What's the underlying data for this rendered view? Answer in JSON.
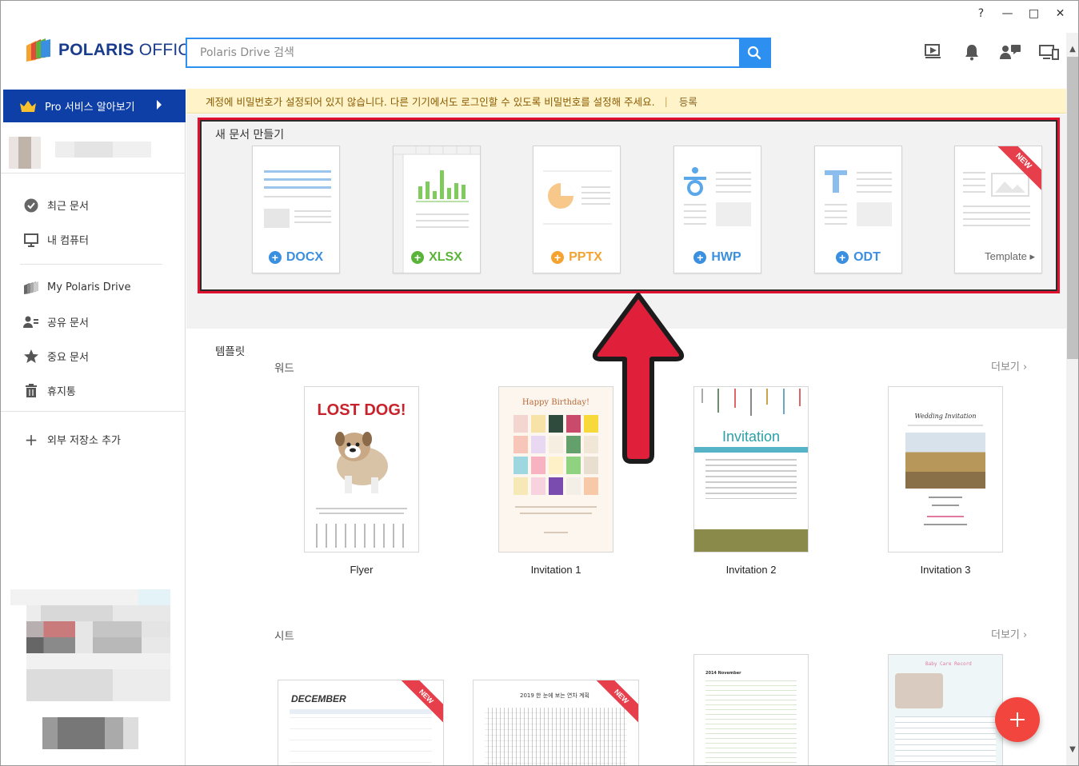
{
  "window": {
    "controls": [
      "?",
      "—",
      "□",
      "✕"
    ]
  },
  "app": {
    "logo_text_bold": "POLARIS",
    "logo_text_light": " OFFICE"
  },
  "search": {
    "placeholder": "Polaris Drive 검색"
  },
  "header_icons": [
    "present-icon",
    "bell-icon",
    "chat-users-icon",
    "devices-icon"
  ],
  "sidebar": {
    "pro_label": "Pro 서비스 알아보기",
    "items_top": [
      {
        "label": "최근 문서",
        "icon": "check-circle-icon"
      },
      {
        "label": "내 컴퓨터",
        "icon": "monitor-icon"
      }
    ],
    "items_mid": [
      {
        "label": "My Polaris Drive",
        "icon": "drive-icon"
      },
      {
        "label": "공유 문서",
        "icon": "share-users-icon"
      },
      {
        "label": "중요 문서",
        "icon": "star-icon"
      },
      {
        "label": "휴지통",
        "icon": "trash-icon"
      }
    ],
    "add_storage": "외부 저장소 추가"
  },
  "notice": {
    "text": "계정에 비밀번호가 설정되어 있지 않습니다. 다른 기기에서도 로그인할 수 있도록 비밀번호를 설정해 주세요.",
    "divider": "|",
    "action": "등록"
  },
  "new_doc": {
    "title": "새 문서 만들기",
    "types": [
      {
        "label": "DOCX",
        "color": "#3a8fe0"
      },
      {
        "label": "XLSX",
        "color": "#5bb43a"
      },
      {
        "label": "PPTX",
        "color": "#f4a330"
      },
      {
        "label": "HWP",
        "color": "#3a8fe0"
      },
      {
        "label": "ODT",
        "color": "#3a8fe0"
      }
    ],
    "template_label": "Template",
    "new_badge": "NEW"
  },
  "templates": {
    "title": "템플릿",
    "word": {
      "title": "워드",
      "more": "더보기",
      "items": [
        {
          "name": "Flyer",
          "headline": "LOST DOG!"
        },
        {
          "name": "Invitation 1",
          "headline": "Happy Birthday!"
        },
        {
          "name": "Invitation 2",
          "headline": "Invitation"
        },
        {
          "name": "Invitation 3",
          "headline": "Wedding Invitation"
        }
      ]
    },
    "sheet": {
      "title": "시트",
      "more": "더보기",
      "items": [
        {
          "headline": "DECEMBER"
        },
        {
          "headline": "2019 한 눈에 보는 연차 계획"
        },
        {
          "headline": "2014 November"
        },
        {
          "headline": "Baby Care Record"
        }
      ]
    }
  },
  "fab": {
    "label": "+"
  }
}
